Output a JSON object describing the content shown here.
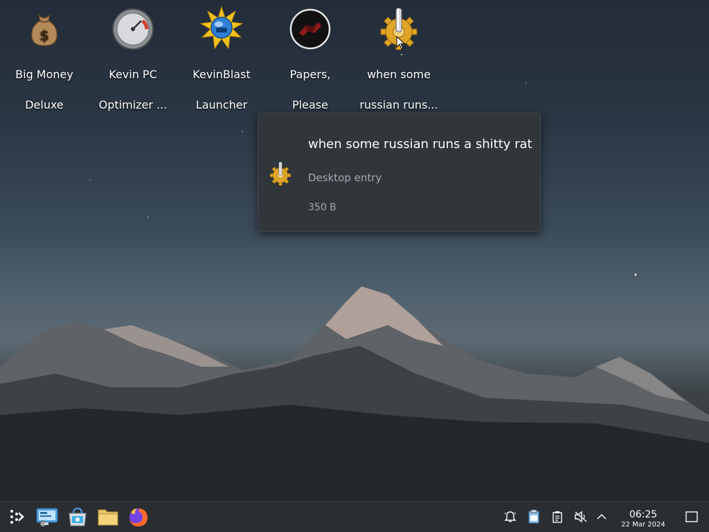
{
  "desktop": {
    "icons": [
      {
        "line1": "Big Money",
        "line2": "Deluxe",
        "icon": "money-bag-icon"
      },
      {
        "line1": "Kevin PC",
        "line2": "Optimizer ...",
        "icon": "speedometer-icon"
      },
      {
        "line1": "KevinBlast",
        "line2": "Launcher",
        "icon": "sun-globe-icon"
      },
      {
        "line1": "Papers,",
        "line2": "Please",
        "icon": "papers-please-icon"
      },
      {
        "line1": "when some",
        "line2": "russian runs...",
        "icon": "gear-tool-icon"
      }
    ]
  },
  "tooltip": {
    "title": "when some russian runs a shitty rat",
    "type": "Desktop entry",
    "size": "350 B",
    "icon": "gear-tool-icon"
  },
  "taskbar": {
    "launcher_icon": "application-launcher-icon",
    "tasks": [
      {
        "name": "system-settings-icon"
      },
      {
        "name": "discover-store-icon"
      },
      {
        "name": "file-manager-icon"
      },
      {
        "name": "firefox-icon"
      }
    ],
    "tray": [
      {
        "name": "notifications-icon"
      },
      {
        "name": "clipboard-vault-icon"
      },
      {
        "name": "clipboard-icon"
      },
      {
        "name": "volume-muted-icon"
      },
      {
        "name": "show-hidden-icons-icon"
      }
    ],
    "clock": {
      "time": "06:25",
      "date": "22 Mar 2024"
    },
    "show_desktop_icon": "show-desktop-icon"
  },
  "colors": {
    "panel": "#2a2e32",
    "tooltip_bg": "#31363b",
    "text": "#fcfcfc",
    "muted_text": "#a1a9b1",
    "accent_gold": "#e0a526"
  }
}
